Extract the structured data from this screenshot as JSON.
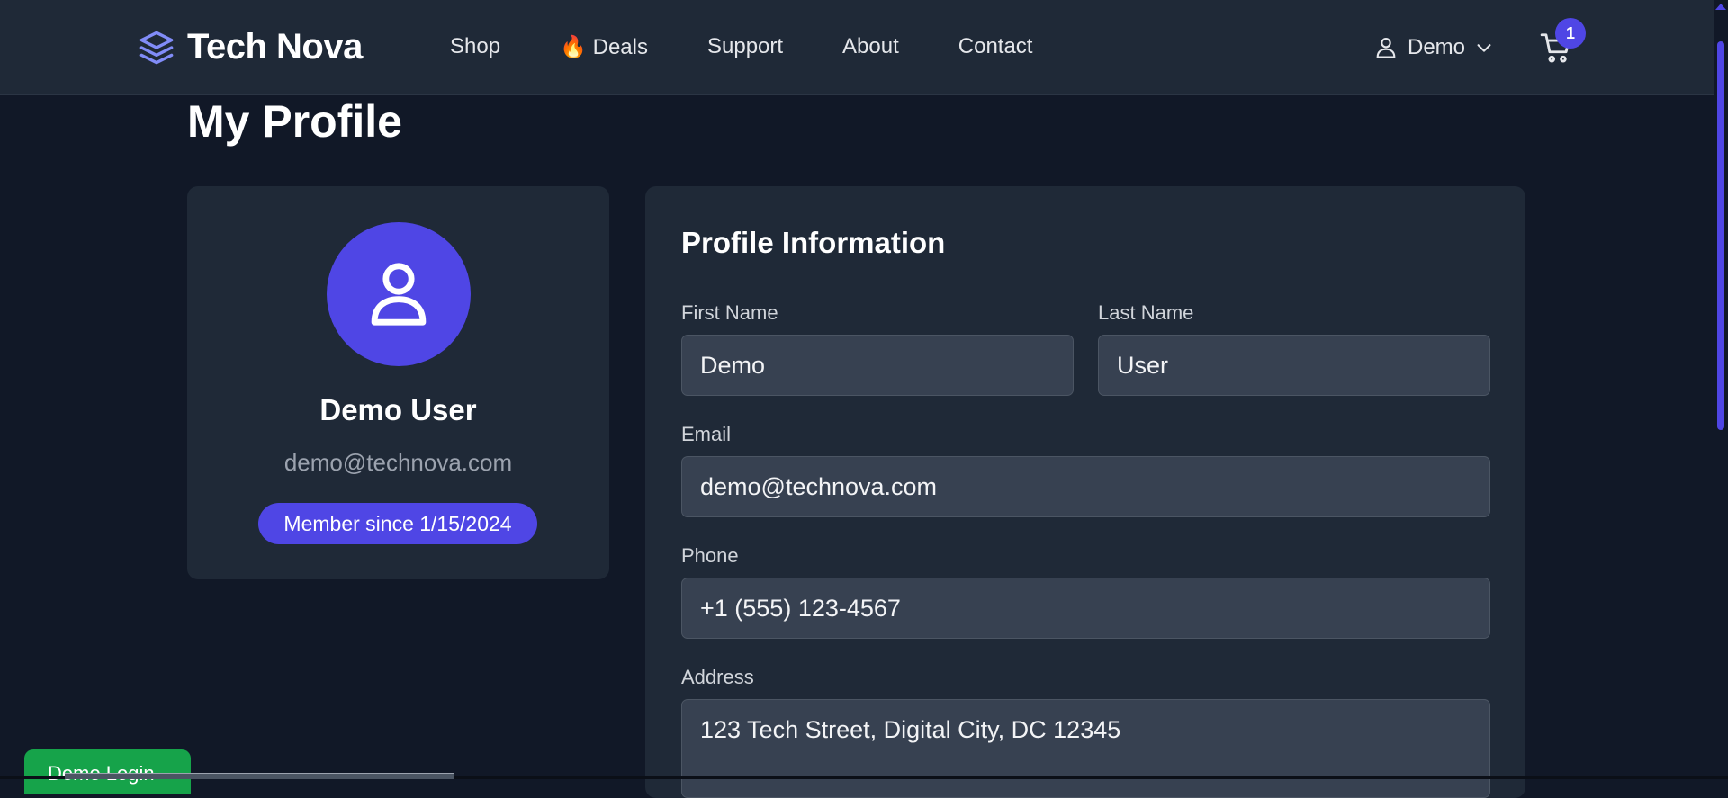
{
  "brand": {
    "name": "Tech Nova",
    "icon": "layers-icon"
  },
  "nav": {
    "links": [
      {
        "label": "Shop"
      },
      {
        "label": "🔥 Deals"
      },
      {
        "label": "Support"
      },
      {
        "label": "About"
      },
      {
        "label": "Contact"
      }
    ]
  },
  "user_menu": {
    "name": "Demo",
    "icon": "user-icon",
    "chevron": "chevron-down-icon"
  },
  "cart": {
    "count": "1",
    "icon": "cart-icon"
  },
  "page": {
    "title": "My Profile"
  },
  "profile_card": {
    "name": "Demo User",
    "email": "demo@technova.com",
    "member_since": "Member since 1/15/2024"
  },
  "profile_info": {
    "title": "Profile Information",
    "first_name": {
      "label": "First Name",
      "value": "Demo"
    },
    "last_name": {
      "label": "Last Name",
      "value": "User"
    },
    "email": {
      "label": "Email",
      "value": "demo@technova.com"
    },
    "phone": {
      "label": "Phone",
      "value": "+1 (555) 123-4567"
    },
    "address": {
      "label": "Address",
      "value": "123 Tech Street, Digital City, DC 12345"
    }
  },
  "demo_login": {
    "label": "Demo Login"
  },
  "colors": {
    "accent": "#4f46e5",
    "background": "#111827",
    "card": "#1f2937",
    "input": "#374151",
    "demo_button": "#16a34a"
  }
}
